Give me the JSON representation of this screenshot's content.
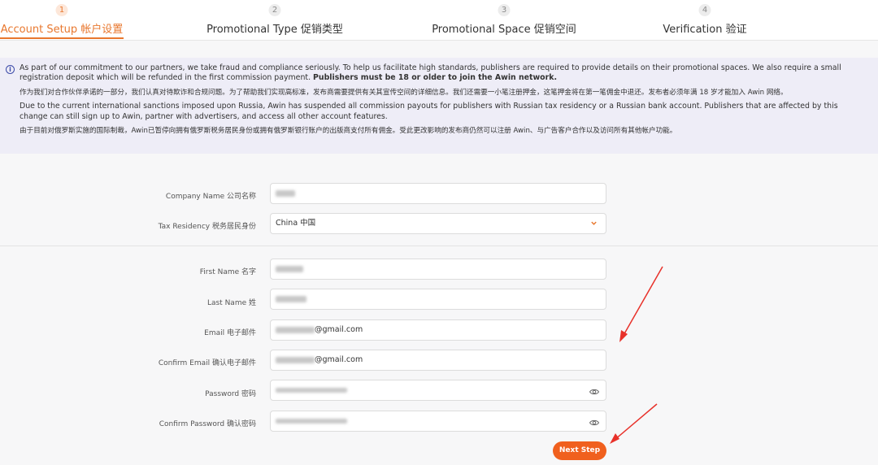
{
  "steps": [
    {
      "num": "1",
      "label": "Account Setup 帐户设置"
    },
    {
      "num": "2",
      "label": "Promotional Type 促销类型"
    },
    {
      "num": "3",
      "label": "Promotional Space 促销空间"
    },
    {
      "num": "4",
      "label": "Verification 验证"
    }
  ],
  "banner": {
    "icon": "i",
    "p1_text": "As part of our commitment to our partners, we take fraud and compliance seriously. To help us facilitate high standards, publishers are required to provide details on their promotional spaces. We also require a small registration deposit which will be refunded in the first commission payment. ",
    "p1_bold": "Publishers must be 18 or older to join the Awin network.",
    "p2": "作为我们对合作伙伴承诺的一部分，我们认真对待欺诈和合规问题。为了帮助我们实现高标准，发布商需要提供有关其宣传空间的详细信息。我们还需要一小笔注册押金，这笔押金将在第一笔佣金中退还。发布者必须年满 18 岁才能加入 Awin 网络。",
    "p3": "Due to the current international sanctions imposed upon Russia, Awin has suspended all commission payouts for publishers with Russian tax residency or a Russian bank account. Publishers that are affected by this change can still sign up to Awin, partner with advertisers, and access all other account features.",
    "p4": "由于目前对俄罗斯实施的国际制裁，Awin已暂停向拥有俄罗斯税务居民身份或拥有俄罗斯银行账户的出版商支付所有佣金。受此更改影响的发布商仍然可以注册 Awin、与广告客户合作以及访问所有其他帐户功能。"
  },
  "form": {
    "company_name_label": "Company Name 公司名称",
    "tax_residency_label": "Tax Residency 税务居民身份",
    "tax_residency_value": "China  中国",
    "first_name_label": "First Name 名字",
    "last_name_label": "Last Name 姓",
    "email_label": "Email 电子邮件",
    "email_suffix": "@gmail.com",
    "confirm_email_label": "Confirm Email 确认电子邮件",
    "confirm_email_suffix": "@gmail.com",
    "password_label": "Password 密码",
    "confirm_password_label": "Confirm Password 确认密码",
    "next_button": "Next Step"
  },
  "colors": {
    "accent": "#e8772e",
    "button": "#f0601e",
    "banner_bg": "#eeedf7",
    "annotation_arrow": "#e8312a"
  },
  "icons": {
    "info": "info-circle-icon",
    "chevron": "chevron-down-icon",
    "eye": "eye-icon"
  }
}
